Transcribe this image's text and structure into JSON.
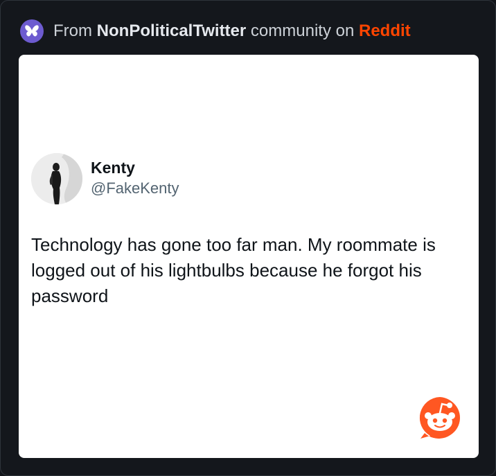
{
  "header": {
    "prefix": "From",
    "community": "NonPoliticalTwitter",
    "middle": "community on",
    "platform": "Reddit",
    "badge_icon": "butterfly-icon",
    "badge_color": "#6d5bd0",
    "platform_color": "#ff4500"
  },
  "tweet": {
    "display_name": "Kenty",
    "handle": "@FakeKenty",
    "text": "Technology has gone too far man. My roommate is logged out of his lightbulbs because he forgot his password",
    "avatar_icon": "profile-avatar"
  },
  "watermark": {
    "icon": "reddit-snoo-icon",
    "color": "#ff5722"
  }
}
